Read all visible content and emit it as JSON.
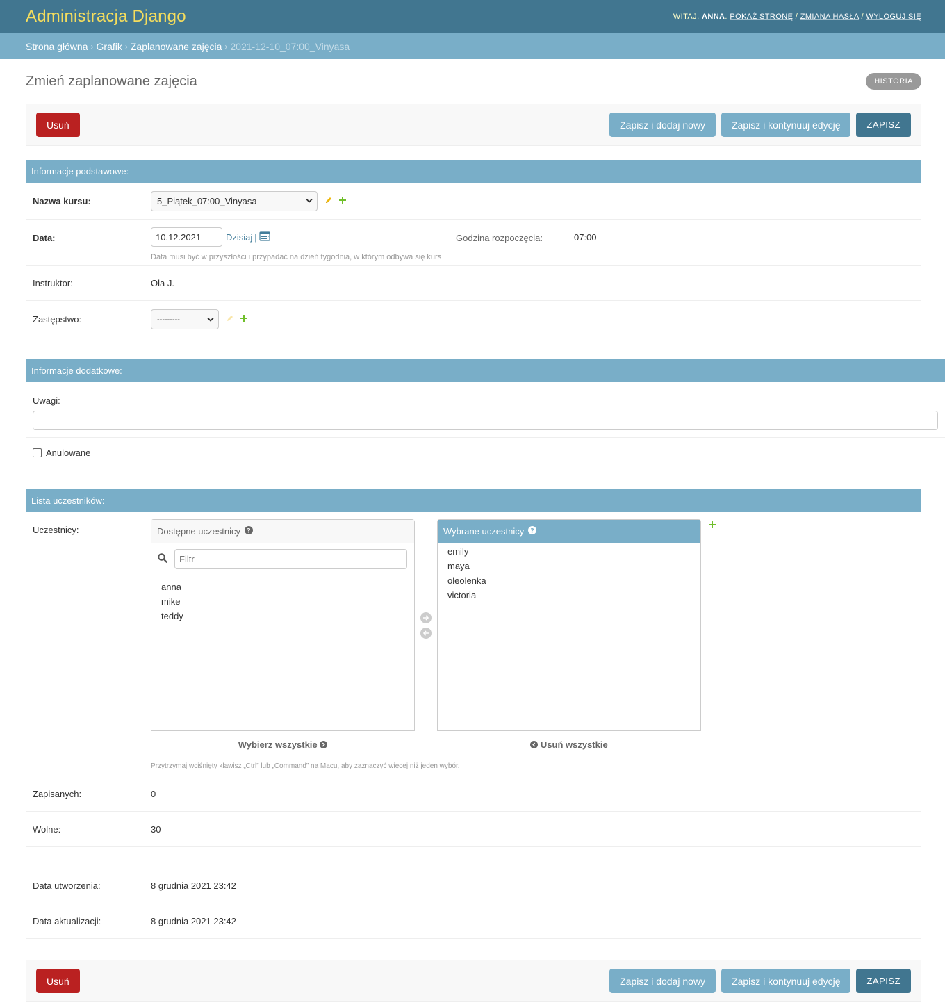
{
  "header": {
    "branding": "Administracja Django",
    "welcome": "Witaj,",
    "user": "anna",
    "view_site": "Pokaż stronę",
    "change_password": "Zmiana hasła",
    "logout": "Wyloguj się"
  },
  "breadcrumbs": {
    "home": "Strona główna",
    "app": "Grafik",
    "model": "Zaplanowane zajęcia",
    "current": "2021-12-10_07:00_Vinyasa"
  },
  "page": {
    "title": "Zmień zaplanowane zajęcia",
    "history": "Historia"
  },
  "submit_row": {
    "delete": "Usuń",
    "save_add": "Zapisz i dodaj nowy",
    "save_continue": "Zapisz i kontynuuj edycję",
    "save": "Zapisz"
  },
  "section_basic": {
    "title": "Informacje podstawowe:",
    "course_label": "Nazwa kursu:",
    "course_value": "5_Piątek_07:00_Vinyasa",
    "date_label": "Data:",
    "date_value": "10.12.2021",
    "today_link": "Dzisiaj",
    "date_help": "Data musi być w przyszłości i przypadać na dzień tygodnia, w którym odbywa się kurs",
    "start_label": "Godzina rozpoczęcia:",
    "start_value": "07:00",
    "instructor_label": "Instruktor:",
    "instructor_value": "Ola J.",
    "substitute_label": "Zastępstwo:",
    "substitute_value": "---------"
  },
  "section_extra": {
    "title": "Informacje dodatkowe:",
    "notes_label": "Uwagi:",
    "notes_value": "",
    "cancelled_label": "Anulowane"
  },
  "section_participants": {
    "title": "Lista uczestników:",
    "participants_label": "Uczestnicy:",
    "available_title": "Dostępne uczestnicy",
    "filter_placeholder": "Filtr",
    "available": [
      "anna",
      "mike",
      "teddy"
    ],
    "chosen_title": "Wybrane uczestnicy",
    "chosen": [
      "emily",
      "maya",
      "oleolenka",
      "victoria"
    ],
    "choose_all": "Wybierz wszystkie",
    "remove_all": "Usuń wszystkie",
    "help": "Przytrzymaj wciśnięty klawisz „Ctrl” lub „Command” na Macu, aby zaznaczyć więcej niż jeden wybór.",
    "enrolled_label": "Zapisanych:",
    "enrolled_value": "0",
    "free_label": "Wolne:",
    "free_value": "30"
  },
  "section_meta": {
    "created_label": "Data utworzenia:",
    "created_value": "8 grudnia 2021 23:42",
    "updated_label": "Data aktualizacji:",
    "updated_value": "8 grudnia 2021 23:42"
  },
  "colors": {
    "header_bg": "#417690",
    "branding": "#f5dd5d",
    "breadcrumbs_bg": "#79aec8",
    "module_header": "#79aec8",
    "delete": "#ba2121",
    "default_button": "#417690",
    "add_icon": "#70bf2b",
    "change_icon": "#efb80b"
  }
}
